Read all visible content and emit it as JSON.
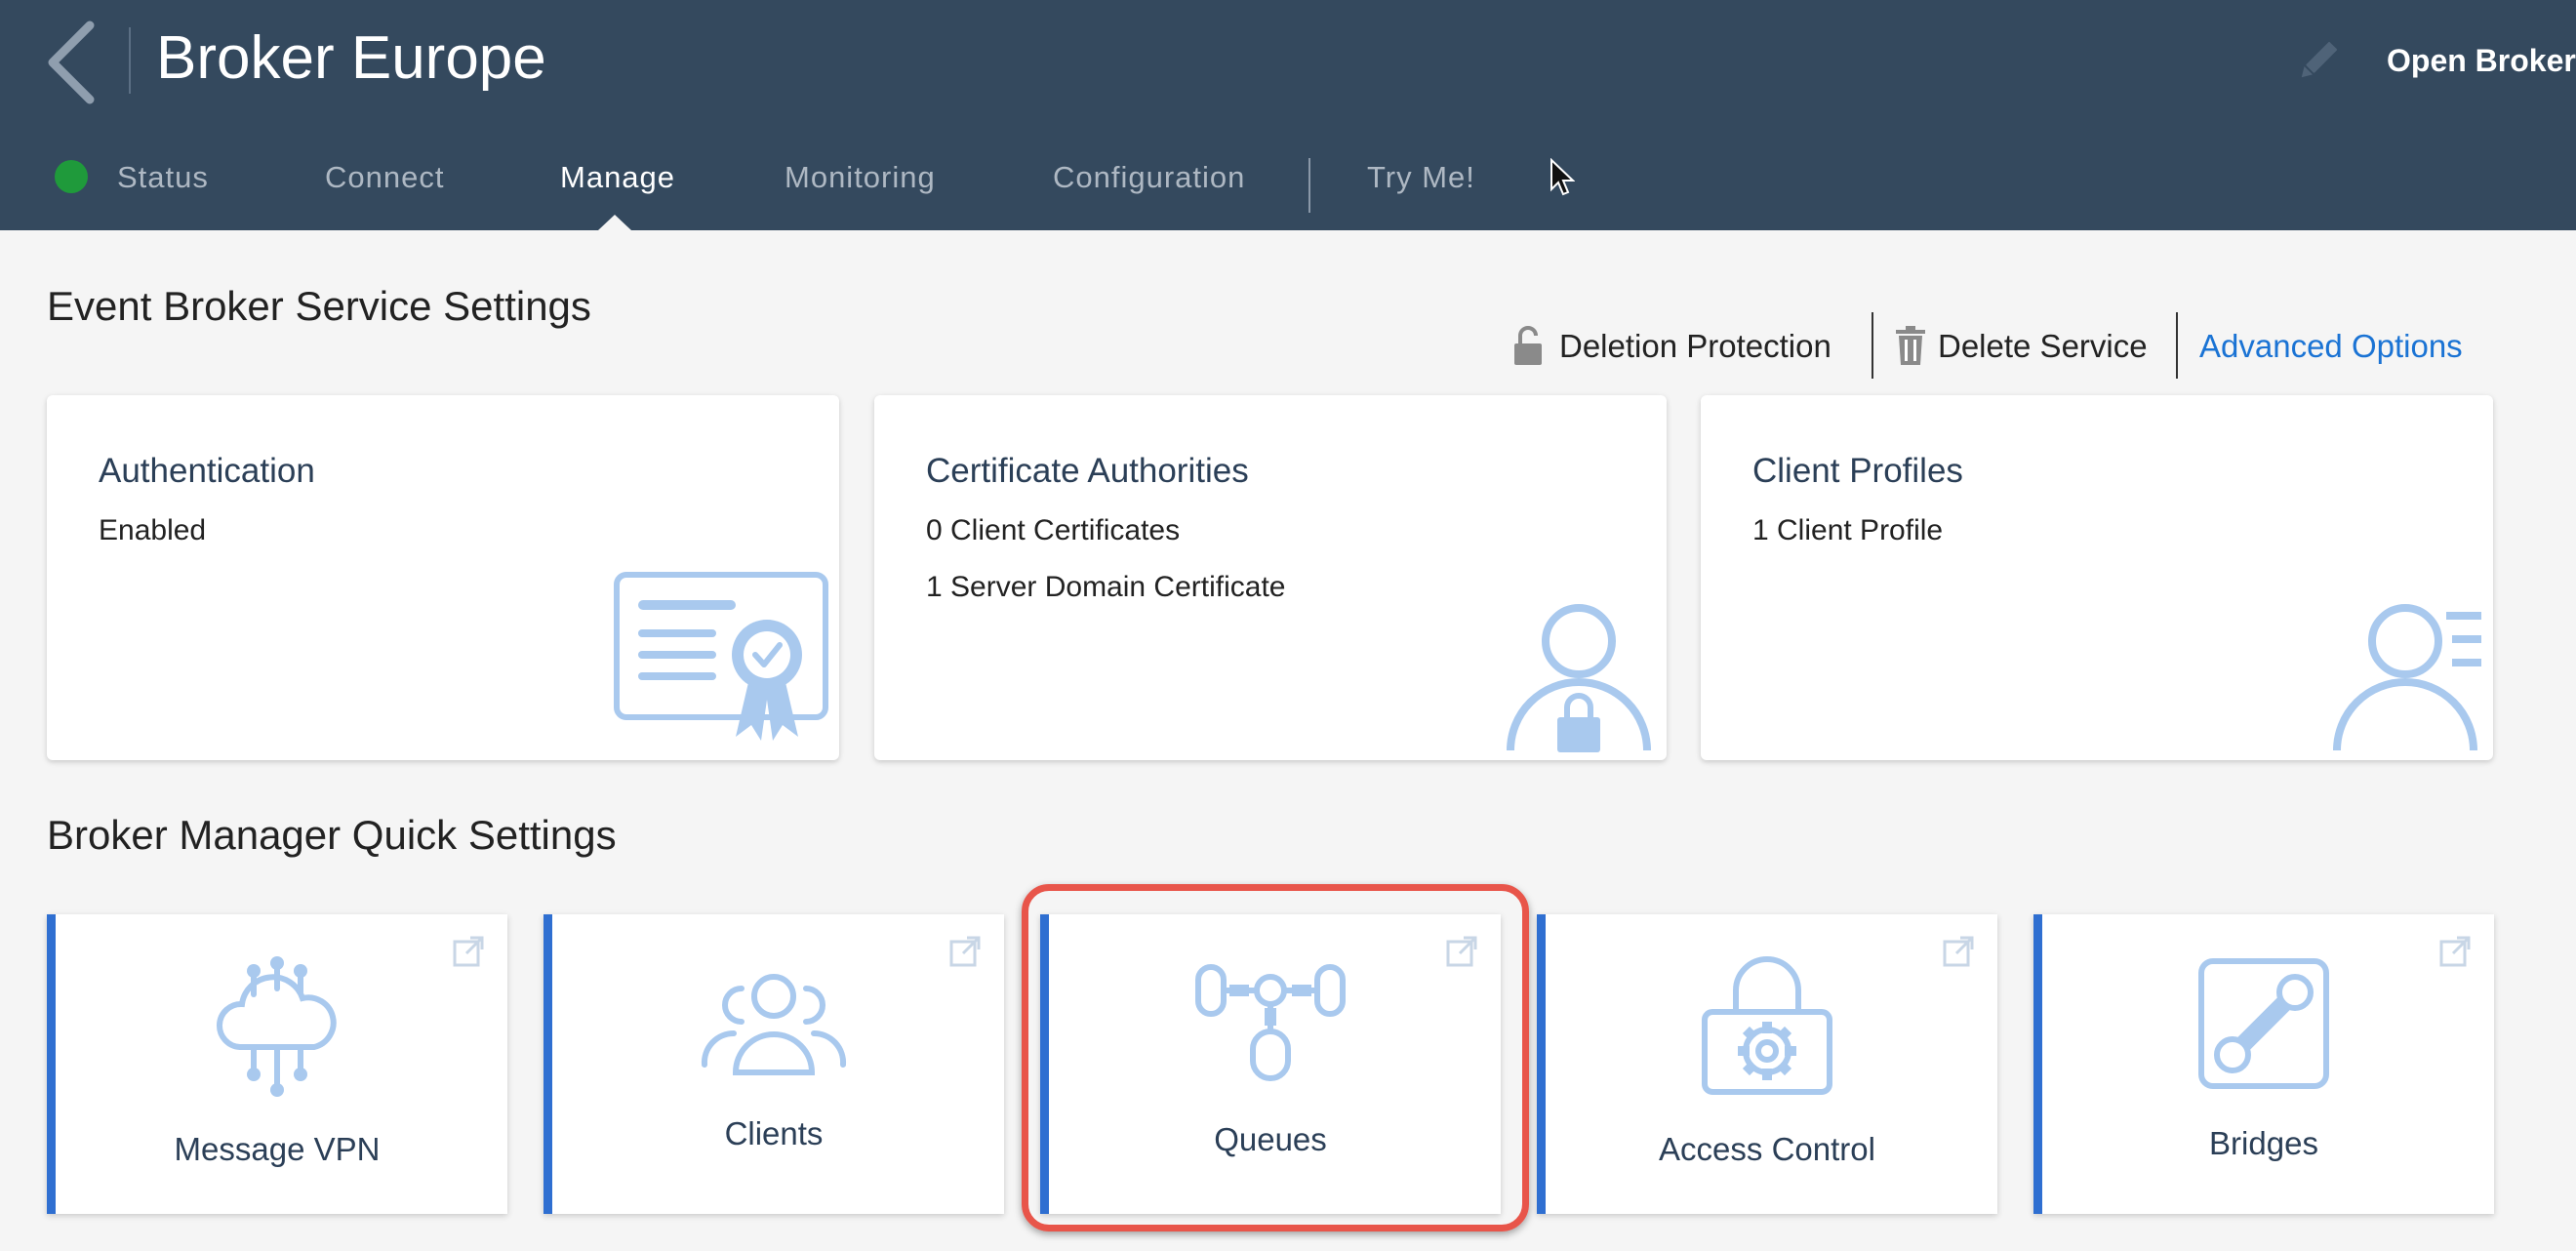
{
  "header": {
    "title": "Broker Europe",
    "open_broker_label": "Open Broker M",
    "background": "#34495e",
    "icons": [
      "back-chevron-icon",
      "pencil-icon",
      "mouse-pointer-icon"
    ]
  },
  "tabs": [
    {
      "label": "Status",
      "status_color": "#1f9a3b"
    },
    {
      "label": "Connect"
    },
    {
      "label": "Manage",
      "active": true
    },
    {
      "label": "Monitoring"
    },
    {
      "label": "Configuration"
    },
    {
      "label": "Try Me!"
    }
  ],
  "settings": {
    "title": "Event Broker Service Settings",
    "actions": {
      "deletion_protection": "Deletion Protection",
      "delete_service": "Delete Service",
      "advanced_options": "Advanced Options"
    },
    "cards": [
      {
        "title": "Authentication",
        "lines": [
          "Enabled"
        ],
        "icon": "certificate-icon"
      },
      {
        "title": "Certificate Authorities",
        "lines": [
          "0 Client Certificates",
          "1 Server Domain Certificate"
        ],
        "icon": "user-lock-icon"
      },
      {
        "title": "Client Profiles",
        "lines": [
          "1 Client Profile"
        ],
        "icon": "user-list-icon"
      }
    ]
  },
  "quick": {
    "title": "Broker Manager Quick Settings",
    "tiles": [
      {
        "label": "Message VPN",
        "icon": "cloud-network-icon"
      },
      {
        "label": "Clients",
        "icon": "users-icon"
      },
      {
        "label": "Queues",
        "icon": "queue-icon",
        "highlighted": true
      },
      {
        "label": "Access Control",
        "icon": "lock-gear-icon"
      },
      {
        "label": "Bridges",
        "icon": "bridge-icon"
      }
    ]
  },
  "colors": {
    "accent": "#2f6fd1",
    "link": "#1a73d4",
    "icon": "#a9c9ee",
    "highlight": "#e8554a"
  }
}
